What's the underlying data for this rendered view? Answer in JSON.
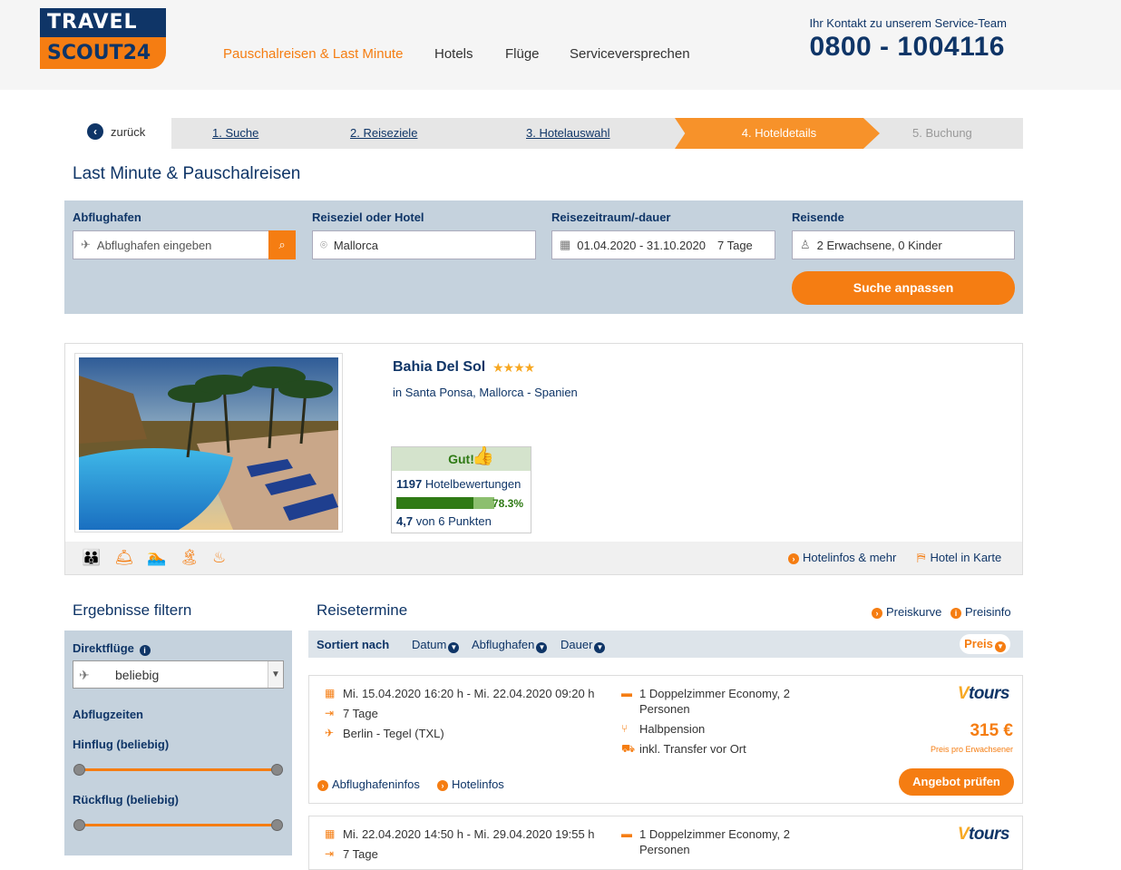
{
  "brand": {
    "line1": "TRAVEL",
    "line2": "SCOUT24"
  },
  "nav": [
    "Pauschalreisen & Last Minute",
    "Hotels",
    "Flüge",
    "Serviceversprechen"
  ],
  "contact": {
    "label": "Ihr Kontakt zu unserem Service-Team",
    "phone": "0800 - 1004116"
  },
  "steps": {
    "back": "zurück",
    "items": [
      "1. Suche",
      "2. Reiseziele",
      "3. Hotelauswahl",
      "4. Hoteldetails",
      "5. Buchung"
    ],
    "active": 3
  },
  "page_title": "Last Minute & Pauschalreisen",
  "search": {
    "airport": {
      "label": "Abflughafen",
      "placeholder": "Abflughafen eingeben"
    },
    "destination": {
      "label": "Reiseziel oder Hotel",
      "value": "Mallorca"
    },
    "period": {
      "label": "Reisezeitraum/-dauer",
      "dates": "01.04.2020 - 31.10.2020",
      "duration": "7 Tage"
    },
    "travellers": {
      "label": "Reisende",
      "value": "2 Erwachsene, 0 Kinder"
    },
    "submit": "Suche anpassen"
  },
  "hotel": {
    "name": "Bahia Del Sol",
    "stars": "★★★★",
    "location": "in Santa Ponsa, Mallorca - Spanien",
    "rating": {
      "verdict": "Gut!",
      "count": "1197",
      "count_label": "Hotelbewertungen",
      "percent": 78.3,
      "percent_label": "78.3%",
      "score": "4,7",
      "score_label": "von 6 Punkten"
    },
    "links": {
      "info": "Hotelinfos & mehr",
      "map": "Hotel in Karte"
    },
    "amenity_icons": [
      "family-icon",
      "service-bell-icon",
      "swimming-icon",
      "beach-icon",
      "spa-icon"
    ]
  },
  "filter": {
    "title": "Ergebnisse filtern",
    "direct": {
      "label": "Direktflüge",
      "value": "beliebig"
    },
    "times_label": "Abflugzeiten",
    "outbound": "Hinflug (beliebig)",
    "return": "Rückflug (beliebig)"
  },
  "results": {
    "title": "Reisetermine",
    "links": {
      "curve": "Preiskurve",
      "info": "Preisinfo"
    },
    "sort": {
      "label": "Sortiert nach",
      "date": "Datum",
      "airport": "Abflughafen",
      "duration": "Dauer",
      "price": "Preis"
    },
    "offers": [
      {
        "dates": "Mi. 15.04.2020 16:20 h - Mi. 22.04.2020 09:20 h",
        "duration": "7 Tage",
        "airport": "Berlin - Tegel (TXL)",
        "room_1": "1 Doppelzimmer Economy, 2",
        "room_2": "Personen",
        "board": "Halbpension",
        "transfer": "inkl. Transfer vor Ort",
        "operator_a": "V",
        "operator_b": "tours",
        "price": "315 €",
        "price_note": "Preis pro Erwachsener",
        "airport_info": "Abflughafeninfos",
        "hotel_info": "Hotelinfos",
        "cta": "Angebot prüfen"
      },
      {
        "dates": "Mi. 22.04.2020 14:50 h - Mi. 29.04.2020 19:55 h",
        "duration": "7 Tage",
        "room_1": "1 Doppelzimmer Economy, 2",
        "room_2": "Personen",
        "operator_a": "V",
        "operator_b": "tours"
      }
    ]
  },
  "colors": {
    "brand_navy": "#0f3567",
    "brand_orange": "#f57d12",
    "rating_green": "#2f7a15"
  }
}
